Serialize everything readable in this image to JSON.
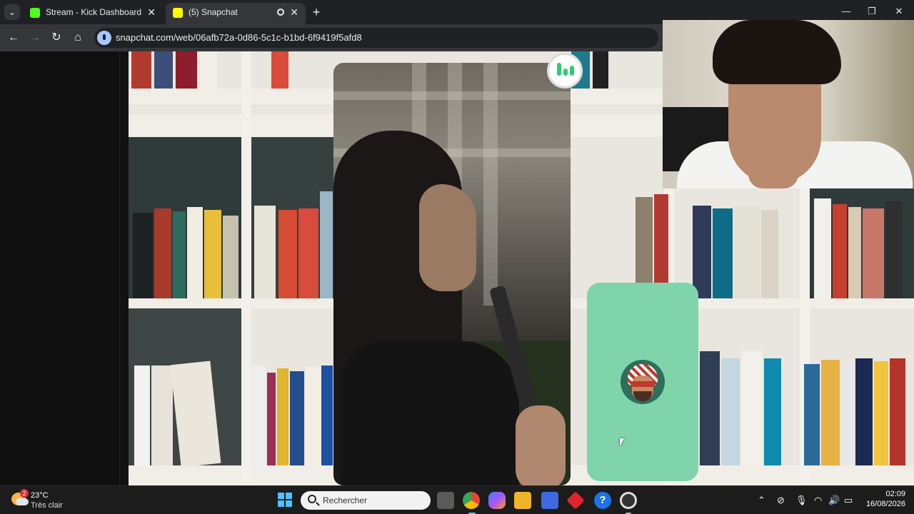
{
  "browser": {
    "tabs": [
      {
        "title": "Stream - Kick Dashboard",
        "favicon": "kick-icon",
        "active": false
      },
      {
        "title": "(5) Snapchat",
        "favicon": "snapchat-ghost-icon",
        "active": true
      }
    ],
    "close_glyph": "✕",
    "newtab_glyph": "+",
    "url": "snapchat.com/web/06afb72a-0d86-5c1c-b1bd-6f9419f5afd8",
    "window_controls": [
      "—",
      "❐",
      "✕"
    ],
    "nav_glyphs": {
      "back": "←",
      "forward": "→",
      "reload": "↻",
      "home": "⌂",
      "menu": "⌄"
    }
  },
  "call": {
    "audio_indicator": "speaking-indicator-icon",
    "avatar_tile_color": "#7fd4ac"
  },
  "taskbar": {
    "weather": {
      "badge": "2",
      "temperature": "23°C",
      "condition": "Très clair"
    },
    "search_placeholder": "Rechercher",
    "apps": [
      "file-explorer-icon",
      "chrome-icon",
      "copilot-icon",
      "folder-icon",
      "store-icon",
      "app-icon",
      "help-icon",
      "obs-icon"
    ],
    "tray": {
      "chevron": "⌃",
      "mic": "🎙",
      "wifi": "◠",
      "volume": "🔊",
      "battery": "▭"
    },
    "time": "02:09",
    "date": "16/08/2026"
  },
  "colors": {
    "accent_blue": "#4cc2ff",
    "chrome_dark": "#202124",
    "speaking_green": "#2ecc71"
  }
}
